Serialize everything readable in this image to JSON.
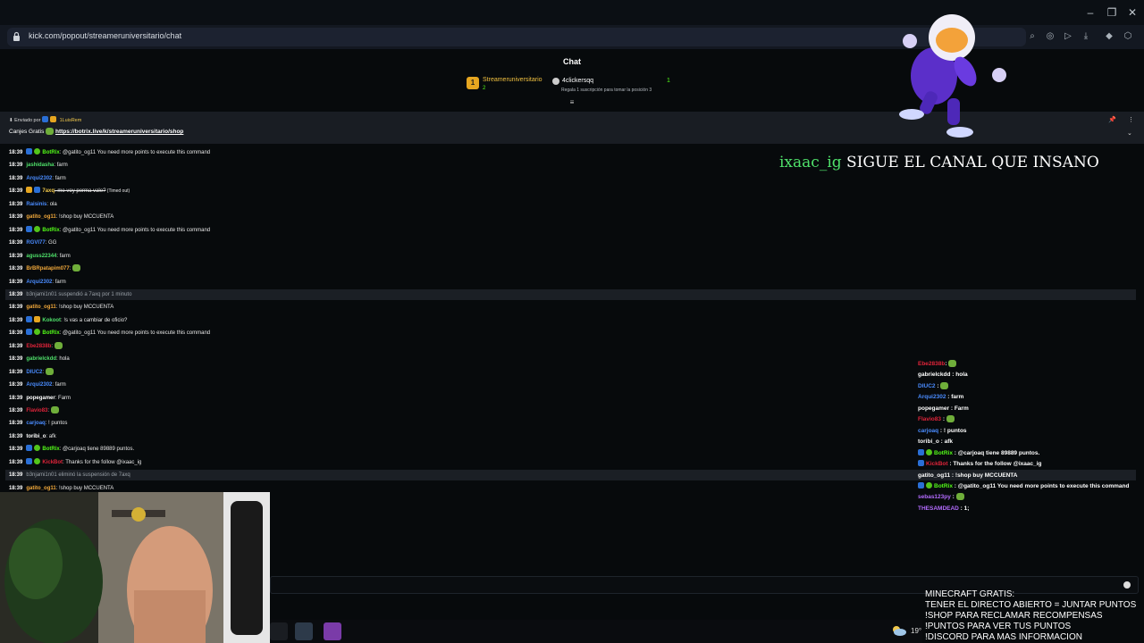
{
  "browser": {
    "url": "kick.com/popout/streameruniversitario/chat",
    "window_controls": [
      "minimize-icon",
      "restore-icon",
      "close-icon"
    ],
    "toolbar_icons": [
      "zoom-icon",
      "shield-icon",
      "play-icon",
      "download-icon",
      "extension-icon",
      "cube-icon"
    ]
  },
  "chat": {
    "title": "Chat",
    "leaderboard": [
      {
        "rank": "1",
        "name": "Streameruniversitario",
        "count": "2"
      },
      {
        "name": "4clickersqq",
        "count": "1",
        "hint": "Regala 1 suscripción para tomar la posición 3"
      }
    ],
    "pinned": {
      "label": "Enviado por",
      "user": "1LuisRem",
      "text": "Canjes Gratis",
      "link": "https://botrix.live/k/streameruniversitario/shop"
    },
    "messages": [
      {
        "time": "18:39",
        "badges": [
          "mod",
          "ver"
        ],
        "user": "BotRix",
        "color": "#53fc18",
        "text": ": @gatito_og11 You need more points to execute this command"
      },
      {
        "time": "18:39",
        "user": "jashidasha",
        "color": "#4fe06a",
        "text": ": farm"
      },
      {
        "time": "18:39",
        "user": "Arqui2302",
        "color": "#4a8cff",
        "text": ": farm"
      },
      {
        "time": "18:39",
        "badges": [
          "sub",
          "mod"
        ],
        "user": "7axq",
        "color": "#f2c94c",
        "text": ": me voy perma vale?",
        "strike": true,
        "suffix": " (Timed out)"
      },
      {
        "time": "18:39",
        "user": "Raisinis",
        "color": "#4a8cff",
        "text": ": ola"
      },
      {
        "time": "18:39",
        "user": "gatito_og11",
        "color": "#f2a93b",
        "text": ": !shop buy MCCUENTA"
      },
      {
        "time": "18:39",
        "badges": [
          "mod",
          "ver"
        ],
        "user": "BotRix",
        "color": "#53fc18",
        "text": ": @gatito_og11 You need more points to execute this command"
      },
      {
        "time": "18:39",
        "user": "RGVI77",
        "color": "#4a8cff",
        "text": ": GG"
      },
      {
        "time": "18:39",
        "user": "aguss22344",
        "color": "#4fe06a",
        "text": ": farm"
      },
      {
        "time": "18:39",
        "user": "BrBRpatapim077",
        "color": "#f2a93b",
        "text": ":",
        "emote": true
      },
      {
        "time": "18:39",
        "user": "Arqui2302",
        "color": "#4a8cff",
        "text": ": farm"
      },
      {
        "time": "18:39",
        "event": true,
        "text": "b3njami1n01 suspendió a 7axq por 1 minuto"
      },
      {
        "time": "18:39",
        "user": "gatito_og11",
        "color": "#f2a93b",
        "text": ": !shop buy MCCUENTA"
      },
      {
        "time": "18:39",
        "badges": [
          "mod",
          "sub"
        ],
        "user": "Kokoot",
        "color": "#4fe06a",
        "text": ": !s vas a cambiar de oficio?"
      },
      {
        "time": "18:39",
        "badges": [
          "mod",
          "ver"
        ],
        "user": "BotRix",
        "color": "#53fc18",
        "text": ": @gatito_og11 You need more points to execute this command"
      },
      {
        "time": "18:39",
        "user": "Ebe2838b",
        "color": "#e0243a",
        "text": ":",
        "emote": true
      },
      {
        "time": "18:39",
        "user": "gabrielckdd",
        "color": "#4fe06a",
        "text": ": hola"
      },
      {
        "time": "18:39",
        "user": "DIUC2",
        "color": "#4a8cff",
        "text": ":",
        "emote": true
      },
      {
        "time": "18:39",
        "user": "Arqui2302",
        "color": "#4a8cff",
        "text": ": farm"
      },
      {
        "time": "18:39",
        "user": "popegamer",
        "color": "#ffffff",
        "text": ": Farm"
      },
      {
        "time": "18:39",
        "user": "Flavio83",
        "color": "#e0243a",
        "text": ":",
        "emote": true
      },
      {
        "time": "18:39",
        "user": "carjoaq",
        "color": "#4a8cff",
        "text": ": ! puntos"
      },
      {
        "time": "18:39",
        "user": "toribi_o",
        "color": "#ffffff",
        "text": ": afk"
      },
      {
        "time": "18:39",
        "badges": [
          "mod",
          "ver"
        ],
        "user": "BotRix",
        "color": "#53fc18",
        "text": ": @carjoaq tiene 89889 puntos."
      },
      {
        "time": "18:39",
        "badges": [
          "mod",
          "ver"
        ],
        "user": "KickBot",
        "color": "#e0243a",
        "text": ": Thanks for the follow @ixaac_ig"
      },
      {
        "time": "18:39",
        "event": true,
        "text": "b3njami1n01 eliminó la suspensión de 7axq"
      },
      {
        "time": "18:39",
        "user": "gatito_og11",
        "color": "#f2a93b",
        "text": ": !shop buy MCCUENTA"
      }
    ]
  },
  "overlay": {
    "follow_user": "ixaac_ig",
    "follow_text": "SIGUE EL CANAL QUE INSANO",
    "chat": [
      {
        "user": "Ebe2838b",
        "color": "#e0243a",
        "text": ":",
        "emote": true
      },
      {
        "user": "gabrielckdd",
        "color": "#ffffff",
        "text": " : hola"
      },
      {
        "user": "DIUC2",
        "color": "#4a8cff",
        "text": " :",
        "emote": true
      },
      {
        "user": "Arqui2302",
        "color": "#4a8cff",
        "text": " : farm"
      },
      {
        "user": "popegamer",
        "color": "#ffffff",
        "text": " : Farm"
      },
      {
        "user": "Flavio83",
        "color": "#e0243a",
        "text": " :",
        "emote": true
      },
      {
        "user": "carjoaq",
        "color": "#4a8cff",
        "text": " : ! puntos"
      },
      {
        "user": "toribi_o",
        "color": "#ffffff",
        "text": " : afk"
      },
      {
        "user": "BotRix",
        "color": "#53fc18",
        "badges": [
          "mod",
          "ver"
        ],
        "text": " : @carjoaq tiene 89889 puntos."
      },
      {
        "user": "KickBot",
        "color": "#e0243a",
        "badges": [
          "mod"
        ],
        "text": " : Thanks for the follow @ixaac_ig"
      },
      {
        "user": "gatito_og11",
        "color": "#ffffff",
        "text": " : !shop buy MCCUENTA"
      },
      {
        "user": "BotRix",
        "color": "#53fc18",
        "badges": [
          "mod",
          "ver"
        ],
        "text": " : @gatito_og11 You need more points to execute this command"
      },
      {
        "user": "sebas123py",
        "color": "#b46cff",
        "text": " :",
        "emote": true
      },
      {
        "user": "THESAMDEAD",
        "color": "#b46cff",
        "text": " : 1;"
      }
    ],
    "commands": [
      "MINECRAFT GRATIS:",
      "TENER EL DIRECTO ABIERTO = JUNTAR PUNTOS",
      "!SHOP PARA RECLAMAR RECOMPENSAS",
      "!PUNTOS PARA VER TUS PUNTOS",
      "!DISCORD PARA MAS INFORMACION"
    ],
    "temperature": "19°"
  }
}
